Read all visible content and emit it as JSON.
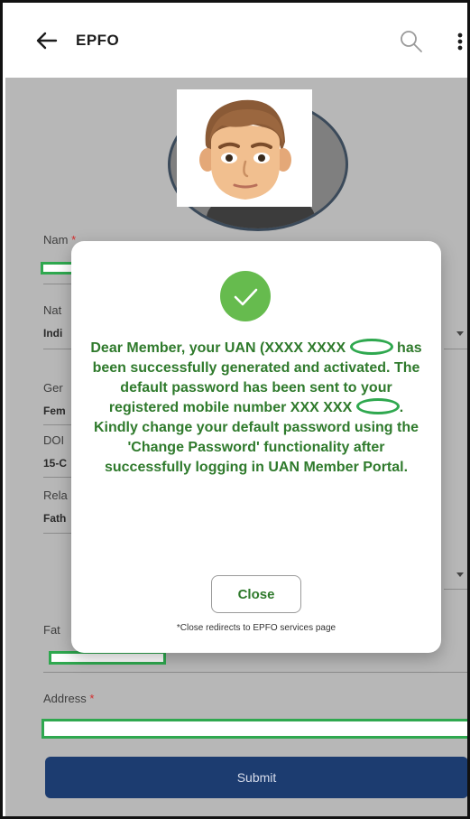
{
  "appbar": {
    "title": "EPFO"
  },
  "form": {
    "labels": {
      "name": "Nam",
      "nationality": "Nat",
      "gender": "Ger",
      "dob": "DOI",
      "relation": "Rela",
      "father": "Fat",
      "address": "Address"
    },
    "required_mark": "*",
    "values": {
      "nationality": "Indi",
      "gender": "Fem",
      "dob": "15-C",
      "relation": "Fath"
    },
    "submit_label": "Submit"
  },
  "dialog": {
    "msg_part1": "Dear Member, your UAN (XXXX XXXX",
    "msg_part2": "has been successfully generated and activated. The default password has been sent to your registered mobile number XXX XXX",
    "msg_part3": ". Kindly change your default password using the 'Change Password' functionality after successfully logging in UAN Member Portal.",
    "close_label": "Close",
    "close_note": "*Close redirects to EPFO services page"
  },
  "colors": {
    "accent_green": "#66bb4e",
    "text_green": "#2f7a2c",
    "submit_blue": "#1c3c70",
    "redaction_green": "#2fa84f"
  }
}
